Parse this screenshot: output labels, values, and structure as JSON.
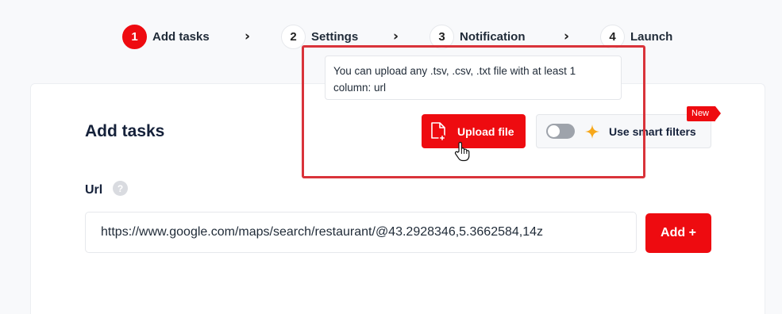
{
  "stepper": {
    "steps": [
      {
        "num": "1",
        "label": "Add tasks",
        "active": true
      },
      {
        "num": "2",
        "label": "Settings",
        "active": false
      },
      {
        "num": "3",
        "label": "Notification",
        "active": false
      },
      {
        "num": "4",
        "label": "Launch",
        "active": false
      }
    ],
    "separator": "›"
  },
  "tooltip": {
    "text": "You can upload any .tsv, .csv, .txt file with at least 1 column: url"
  },
  "card": {
    "title": "Add tasks",
    "upload_button": "Upload file",
    "smart_filters": {
      "label": "Use smart filters",
      "badge": "New",
      "toggle_on": false
    },
    "url_field": {
      "label": "Url",
      "help": "?",
      "value": "https://www.google.com/maps/search/restaurant/@43.2928346,5.3662584,14z"
    },
    "add_button": "Add +"
  },
  "colors": {
    "accent": "#ee0b10",
    "highlight": "#d9333a",
    "sparkle": "#f7a81b"
  },
  "icons": [
    "file-add-icon",
    "sparkle-icon",
    "help-icon",
    "chevron-right-icon",
    "hand-pointer-icon"
  ]
}
